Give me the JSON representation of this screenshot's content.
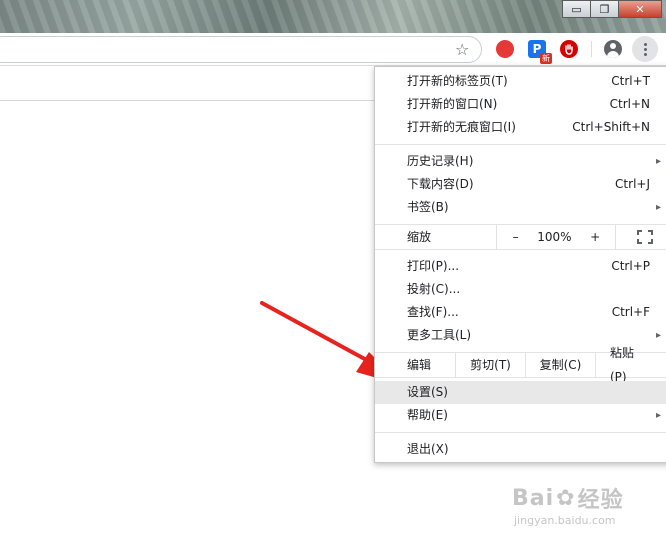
{
  "window": {
    "minimize_glyph": "▭",
    "restore_glyph": "❐",
    "close_glyph": "✕"
  },
  "toolbar": {
    "bookmark_icon": "☆",
    "ext_p_letter": "P",
    "ext_p_badge": "新"
  },
  "menu": {
    "new_tab": {
      "label": "打开新的标签页(T)",
      "shortcut": "Ctrl+T"
    },
    "new_window": {
      "label": "打开新的窗口(N)",
      "shortcut": "Ctrl+N"
    },
    "new_incognito": {
      "label": "打开新的无痕窗口(I)",
      "shortcut": "Ctrl+Shift+N"
    },
    "history": {
      "label": "历史记录(H)"
    },
    "downloads": {
      "label": "下载内容(D)",
      "shortcut": "Ctrl+J"
    },
    "bookmarks": {
      "label": "书签(B)"
    },
    "zoom": {
      "label": "缩放",
      "minus": "–",
      "value": "100%",
      "plus": "+"
    },
    "print": {
      "label": "打印(P)...",
      "shortcut": "Ctrl+P"
    },
    "cast": {
      "label": "投射(C)..."
    },
    "find": {
      "label": "查找(F)...",
      "shortcut": "Ctrl+F"
    },
    "more_tools": {
      "label": "更多工具(L)"
    },
    "edit": {
      "label": "编辑",
      "cut": "剪切(T)",
      "copy": "复制(C)",
      "paste": "粘贴(P)"
    },
    "settings": {
      "label": "设置(S)"
    },
    "help": {
      "label": "帮助(E)"
    },
    "exit": {
      "label": "退出(X)"
    }
  },
  "watermark": {
    "brand": "Bai",
    "brand_tail": "经验",
    "url": "jingyan.baidu.com"
  },
  "colors": {
    "annotation_arrow": "#e8231d",
    "menu_highlight": "#e8e8e9"
  }
}
